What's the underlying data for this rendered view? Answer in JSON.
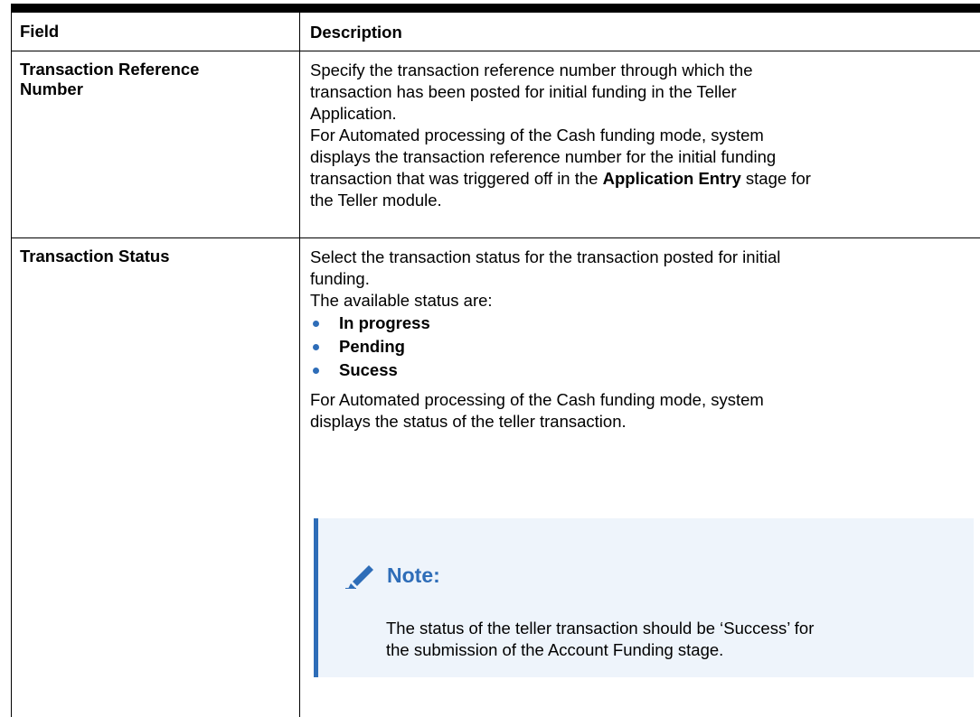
{
  "table": {
    "header": {
      "field": "Field",
      "description": "Description"
    },
    "rows": [
      {
        "field": "Transaction Reference Number",
        "field_lines": [
          "Transaction Reference",
          "Number"
        ],
        "lines": [
          "Specify the transaction reference number through which the",
          "transaction has been posted for initial funding in the Teller",
          "Application.",
          "For Automated processing of the Cash funding mode, system",
          "displays the transaction reference number for the initial funding"
        ],
        "line6_pre": "transaction that was triggered off in the ",
        "line6_bold": "Application Entry",
        "line6_post": " stage for",
        "line7": "the Teller module."
      },
      {
        "field": "Transaction Status",
        "lines": [
          "Select the transaction status for the transaction posted for initial",
          "funding.",
          "The available status are:"
        ],
        "statuses": [
          "In progress",
          "Pending",
          "Sucess"
        ],
        "after_lines": [
          "For Automated processing of the Cash funding mode, system",
          "displays the status of the teller transaction."
        ],
        "note": {
          "icon": "pencil-icon",
          "title": "Note:",
          "lines": [
            "The status of the teller transaction should be ‘Success’ for",
            "the submission of the Account Funding stage."
          ]
        }
      }
    ]
  },
  "colors": {
    "accent": "#2e6db8",
    "note_background": "#eef4fb"
  }
}
